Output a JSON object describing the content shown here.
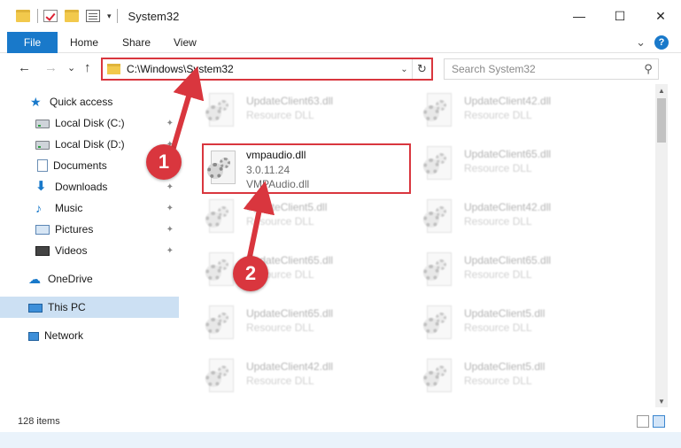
{
  "window": {
    "title": "System32",
    "minimize": "—",
    "maximize": "☐",
    "close": "✕"
  },
  "ribbon": {
    "tabs": [
      "File",
      "Home",
      "Share",
      "View"
    ],
    "expand_glyph": "⌄",
    "help_glyph": "?"
  },
  "nav": {
    "back": "←",
    "forward": "→",
    "recent": "⌄",
    "up": "↑"
  },
  "address": {
    "path": "C:\\Windows\\System32",
    "dropdown": "⌄",
    "refresh": "↻"
  },
  "search": {
    "placeholder": "Search System32",
    "icon": "search-icon"
  },
  "sidebar": {
    "items": [
      {
        "label": "Quick access",
        "icon": "star-icon"
      },
      {
        "label": "Local Disk (C:)",
        "icon": "drive-icon",
        "pinned": true
      },
      {
        "label": "Local Disk (D:)",
        "icon": "drive-icon",
        "pinned": true
      },
      {
        "label": "Documents",
        "icon": "documents-icon",
        "pinned": true
      },
      {
        "label": "Downloads",
        "icon": "download-icon",
        "pinned": true
      },
      {
        "label": "Music",
        "icon": "music-icon",
        "pinned": true
      },
      {
        "label": "Pictures",
        "icon": "pictures-icon",
        "pinned": true
      },
      {
        "label": "Videos",
        "icon": "videos-icon",
        "pinned": true
      },
      {
        "label": "OneDrive",
        "icon": "cloud-icon"
      },
      {
        "label": "This PC",
        "icon": "computer-icon",
        "selected": true
      },
      {
        "label": "Network",
        "icon": "network-icon"
      }
    ],
    "pin_glyph": "📌"
  },
  "files": {
    "highlighted": {
      "name": "vmpaudio.dll",
      "version": "3.0.11.24",
      "description": "VMPAudio.dll"
    },
    "blurred": [
      {
        "name": "UpdateClient63.dll",
        "type": "Resource DLL"
      },
      {
        "name": "UpdateClient42.dll",
        "type": "Resource DLL"
      },
      {
        "name": "UpdateClient65.dll",
        "type": "Resource DLL"
      },
      {
        "name": "UpdateClient5.dll",
        "type": "Resource DLL"
      },
      {
        "name": "UpdateClient42.dll",
        "type": "Resource DLL"
      },
      {
        "name": "UpdateClient65.dll",
        "type": "Resource DLL"
      },
      {
        "name": "UpdateClient65.dll",
        "type": "Resource DLL"
      },
      {
        "name": "UpdateClient65.dll",
        "type": "Resource DLL"
      },
      {
        "name": "UpdateClient5.dll",
        "type": "Resource DLL"
      },
      {
        "name": "UpdateClient42.dll",
        "type": "Resource DLL"
      },
      {
        "name": "UpdateClient5.dll",
        "type": "Resource DLL"
      }
    ]
  },
  "status": {
    "item_count": "128 items"
  },
  "annotations": {
    "step1": "1",
    "step2": "2",
    "color": "#d9363e"
  },
  "scroll": {
    "up": "▲",
    "down": "▼"
  }
}
